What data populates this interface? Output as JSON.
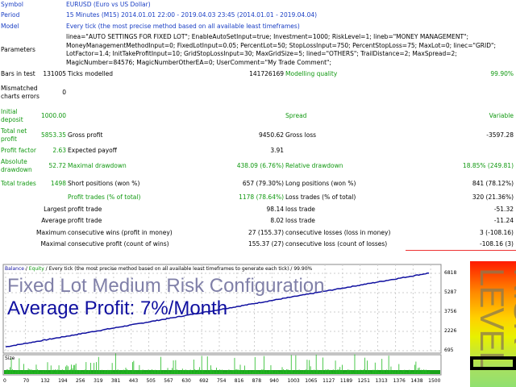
{
  "report": {
    "symbol_label": "Symbol",
    "symbol": "EURUSD (Euro vs US Dollar)",
    "period_label": "Period",
    "period": "15 Minutes (M15) 2014.01.01 22:00 - 2019.04.03 23:45 (2014.01.01 - 2019.04.04)",
    "model_label": "Model",
    "model": "Every tick (the most precise method based on all available least timeframes)",
    "parameters_label": "Parameters",
    "parameters": [
      "linea=\"AUTO SETTINGS FOR FIXED LOT\"; EnableAutoSetInput=true; Investment=1000; RiskLevel=1; lineb=\"MONEY MANAGEMENT\";",
      "MoneyManagementMethodInput=0; FixedLotInput=0.05; PercentLot=50; StopLossInput=750; PercentStopLoss=75; MaxLot=0; linec=\"GRID\";",
      "LotFactor=1.4; InitTakeProfitInput=10; GridStopLossInput=30; MaxGridSize=5; lined=\"OTHERS\"; TrailDistance=2; MaxSpread=2;",
      "MagicNumber=84576; MagicNumberOtherEA=0; UserComment=\"My Trade Comment\";"
    ],
    "bars_label": "Bars in test",
    "bars": "131005",
    "ticks_label": "Ticks modelled",
    "ticks": "141726169",
    "quality_label": "Modelling quality",
    "quality": "99.90%",
    "mismatch_label": "Mismatched charts errors",
    "mismatch": "0",
    "deposit_label": "Initial deposit",
    "deposit": "1000.00",
    "spread_label": "Spread",
    "spread": "Variable",
    "net_label": "Total net profit",
    "net": "5853.35",
    "gp_label": "Gross profit",
    "gp": "9450.62",
    "gl_label": "Gross loss",
    "gl": "-3597.28",
    "pf_label": "Profit factor",
    "pf": "2.63",
    "ep_label": "Expected payoff",
    "ep": "3.91",
    "ad_label": "Absolute drawdown",
    "ad": "52.72",
    "md_label": "Maximal drawdown",
    "md": "438.09 (6.76%)",
    "rd_label": "Relative drawdown",
    "rd": "18.85% (249.81)",
    "tt_label": "Total trades",
    "tt": "1498",
    "sp_label": "Short positions (won %)",
    "sp": "657 (79.30%)",
    "lp_label": "Long positions (won %)",
    "lp": "841 (78.12%)",
    "pt_label": "Profit trades (% of total)",
    "pt": "1178 (78.64%)",
    "lt_label": "Loss trades (% of total)",
    "lt": "320 (21.36%)",
    "largest": "Largest",
    "lpt_label": "profit trade",
    "lpt": "98.14",
    "llt_label": "loss trade",
    "llt": "-51.32",
    "average": "Average",
    "apt_label": "profit trade",
    "apt": "8.02",
    "alt_label": "loss trade",
    "alt": "-11.24",
    "maximum": "Maximum",
    "mcw_label": "consecutive wins (profit in money)",
    "mcw": "27 (155.37)",
    "mcl_label": "consecutive losses (loss in money)",
    "mcl": "3 (-108.16)",
    "maximal": "Maximal",
    "mcp_label": "consecutive profit (count of wins)",
    "mcp": "155.37 (27)",
    "mclo_label": "consecutive loss (count of losses)",
    "mclo": "-108.16 (3)"
  },
  "chart": {
    "balance": "Balance",
    "sep1": " / ",
    "equity": "Equity",
    "header_rest": " / Every tick (the most precise method based on all available least timeframes to generate each tick) / 99.90%",
    "size_label": "Size",
    "watermark1": "Fixed Lot Medium Risk Configuration",
    "watermark2": "Average Profit: 7%/Month",
    "risk_label": "RISK LEVEL"
  },
  "chart_data": {
    "type": "line",
    "title": "Balance / Equity",
    "y_ticks": [
      "6818",
      "5287",
      "3756",
      "2226",
      "695"
    ],
    "ylim": [
      695,
      6818
    ],
    "x_ticks": [
      "0",
      "70",
      "132",
      "194",
      "256",
      "319",
      "381",
      "443",
      "505",
      "567",
      "630",
      "692",
      "754",
      "816",
      "878",
      "940",
      "1003",
      "1065",
      "1127",
      "1189",
      "1251",
      "1313",
      "1376",
      "1438",
      "1500"
    ],
    "xlim": [
      0,
      1528
    ],
    "series": [
      {
        "name": "Balance",
        "start": 1000,
        "end": 6853.35,
        "color": "#1010a0"
      }
    ]
  }
}
